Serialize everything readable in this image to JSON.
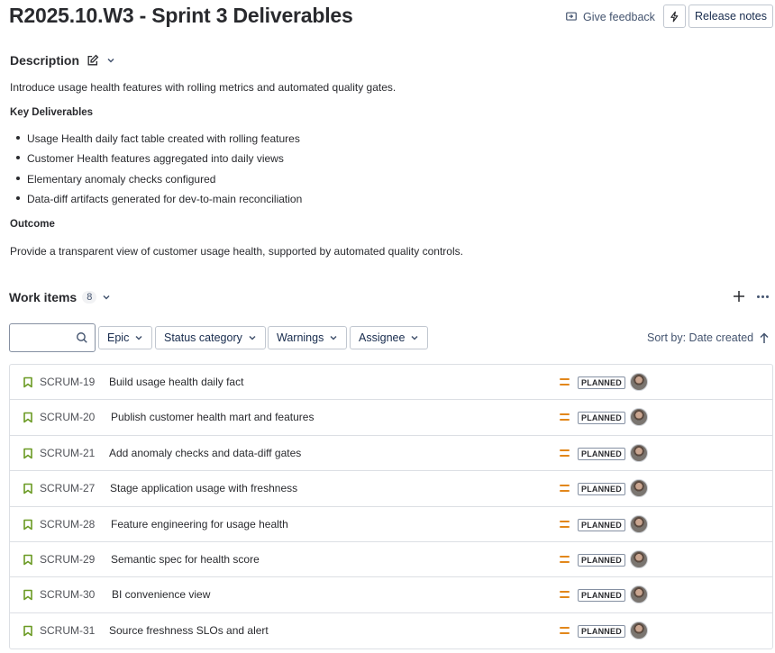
{
  "header": {
    "title": "R2025.10.W3 - Sprint 3 Deliverables",
    "feedback_label": "Give feedback",
    "release_notes_label": "Release notes"
  },
  "description": {
    "heading": "Description",
    "intro": "Introduce usage health features with rolling metrics and automated quality gates.",
    "deliverables_heading": "Key Deliverables",
    "deliverables": [
      "Usage Health daily fact table created with rolling features",
      "Customer Health features aggregated into daily views",
      "Elementary anomaly checks configured",
      "Data-diff artifacts generated for dev-to-main reconciliation"
    ],
    "outcome_heading": "Outcome",
    "outcome": "Provide a transparent view of customer usage health, supported by automated quality controls."
  },
  "work_items": {
    "heading": "Work items",
    "count": "8",
    "search_value": "",
    "filters": [
      "Epic",
      "Status category",
      "Warnings",
      "Assignee"
    ],
    "sort_label": "Sort by: Date created",
    "rows": [
      {
        "key": "SCRUM-19",
        "summary": "Build usage health daily fact",
        "status": "PLANNED"
      },
      {
        "key": "SCRUM-20",
        "summary": "Publish customer health mart and features",
        "status": "PLANNED"
      },
      {
        "key": "SCRUM-21",
        "summary": "Add anomaly checks and data-diff gates",
        "status": "PLANNED"
      },
      {
        "key": "SCRUM-27",
        "summary": "Stage application usage with freshness",
        "status": "PLANNED"
      },
      {
        "key": "SCRUM-28",
        "summary": "Feature engineering for usage health",
        "status": "PLANNED"
      },
      {
        "key": "SCRUM-29",
        "summary": "Semantic spec for health score",
        "status": "PLANNED"
      },
      {
        "key": "SCRUM-30",
        "summary": "BI convenience view",
        "status": "PLANNED"
      },
      {
        "key": "SCRUM-31",
        "summary": "Source freshness SLOs and alert",
        "status": "PLANNED"
      }
    ]
  },
  "colors": {
    "story_icon": "#6a9a23",
    "priority_medium": "#e2871b",
    "text": "#292a2e"
  }
}
